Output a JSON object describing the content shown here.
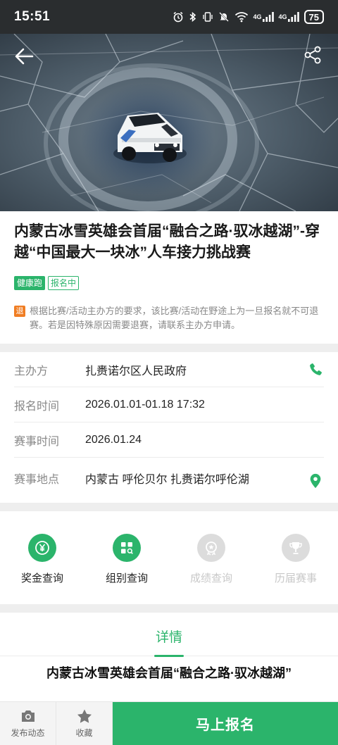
{
  "status_bar": {
    "time": "15:51",
    "network_1": "4G",
    "network_2": "4G",
    "battery": "75",
    "icons": [
      "alarm-icon",
      "bluetooth-icon",
      "vibrate-icon",
      "mute-icon",
      "wifi-icon",
      "signal-icon",
      "signal-icon",
      "battery-icon"
    ]
  },
  "hero": {
    "image": "car-on-ice-photo",
    "back_icon": "back-arrow-icon",
    "share_icon": "share-icon"
  },
  "event": {
    "title": "内蒙古冰雪英雄会首届“融合之路·驭冰越湖”-穿越“中国最大一块冰”人车接力挑战赛",
    "tags": [
      "健康跑",
      "报名中"
    ],
    "refund_badge": "退",
    "refund_notice": "根据比赛/活动主办方的要求，该比赛/活动在野途上为一旦报名就不可退赛。若是因特殊原因需要退赛，请联系主办方申请。"
  },
  "info": [
    {
      "label": "主办方",
      "value": "扎赉诺尔区人民政府",
      "action_icon": "phone-icon"
    },
    {
      "label": "报名时间",
      "value": "2026.01.01-01.18 17:32"
    },
    {
      "label": "赛事时间",
      "value": "2026.01.24"
    },
    {
      "label": "赛事地点",
      "value": "内蒙古 呼伦贝尔 扎赉诺尔呼伦湖",
      "action_icon": "location-pin-icon"
    }
  ],
  "actions": [
    {
      "label": "奖金查询",
      "icon": "yuan-coin-icon",
      "enabled": true
    },
    {
      "label": "组别查询",
      "icon": "group-grid-icon",
      "enabled": true
    },
    {
      "label": "成绩查询",
      "icon": "medal-icon",
      "enabled": false
    },
    {
      "label": "历届赛事",
      "icon": "trophy-icon",
      "enabled": false
    }
  ],
  "detail": {
    "tab_label": "详情",
    "heading": "内蒙古冰雪英雄会首届“融合之路·驭冰越湖”"
  },
  "bottom_bar": {
    "post_label": "发布动态",
    "favorite_label": "收藏",
    "signup_label": "马上报名"
  },
  "colors": {
    "accent": "#2bb46b",
    "refund_badge": "#f07d23",
    "status_bar": "#2a2d2f"
  }
}
